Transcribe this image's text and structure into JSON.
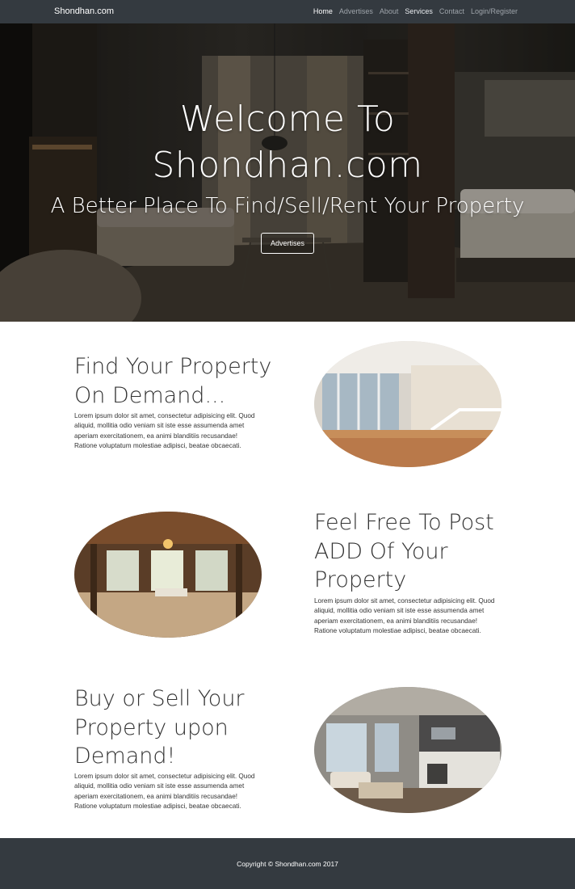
{
  "navbar": {
    "brand": "Shondhan.com",
    "links": [
      {
        "label": "Home"
      },
      {
        "label": "Advertises"
      },
      {
        "label": "About"
      },
      {
        "label": "Services"
      },
      {
        "label": "Contact"
      },
      {
        "label": "Login/Register"
      }
    ]
  },
  "hero": {
    "title_line1": "Welcome To",
    "title_line2": "Shondhan.com",
    "subtitle": "A Better Place To Find/Sell/Rent Your Property",
    "button_label": "Advertises"
  },
  "features": [
    {
      "heading_lines": [
        "Find Your Property",
        "On Demand..."
      ],
      "text_lines": [
        "Lorem ipsum dolor sit amet, consectetur adipisicing elit. Quod",
        "aliquid, mollitia odio veniam sit iste esse assumenda amet",
        "aperiam exercitationem, ea animi blanditiis recusandae!",
        "Ratione voluptatum molestiae adipisci, beatae obcaecati."
      ]
    },
    {
      "heading_lines": [
        "Feel Free To Post",
        "ADD Of Your",
        "Property"
      ],
      "text_lines": [
        "Lorem ipsum dolor sit amet, consectetur adipisicing elit. Quod",
        "aliquid, mollitia odio veniam sit iste esse assumenda amet",
        "aperiam exercitationem, ea animi blanditiis recusandae!",
        "Ratione voluptatum molestiae adipisci, beatae obcaecati."
      ]
    },
    {
      "heading_lines": [
        "Buy or Sell Your",
        "Property upon",
        "Demand!"
      ],
      "text_lines": [
        "Lorem ipsum dolor sit amet, consectetur adipisicing elit. Quod",
        "aliquid, mollitia odio veniam sit iste esse assumenda amet",
        "aperiam exercitationem, ea animi blanditiis recusandae!",
        "Ratione voluptatum molestiae adipisci, beatae obcaecati."
      ]
    }
  ],
  "footer": {
    "copyright": "Copyright © Shondhan.com 2017"
  },
  "colors": {
    "navbar_bg": "#343a40",
    "footer_bg": "#343a40",
    "nav_active": "#ffffff",
    "nav_inactive": "#9ea4aa"
  }
}
